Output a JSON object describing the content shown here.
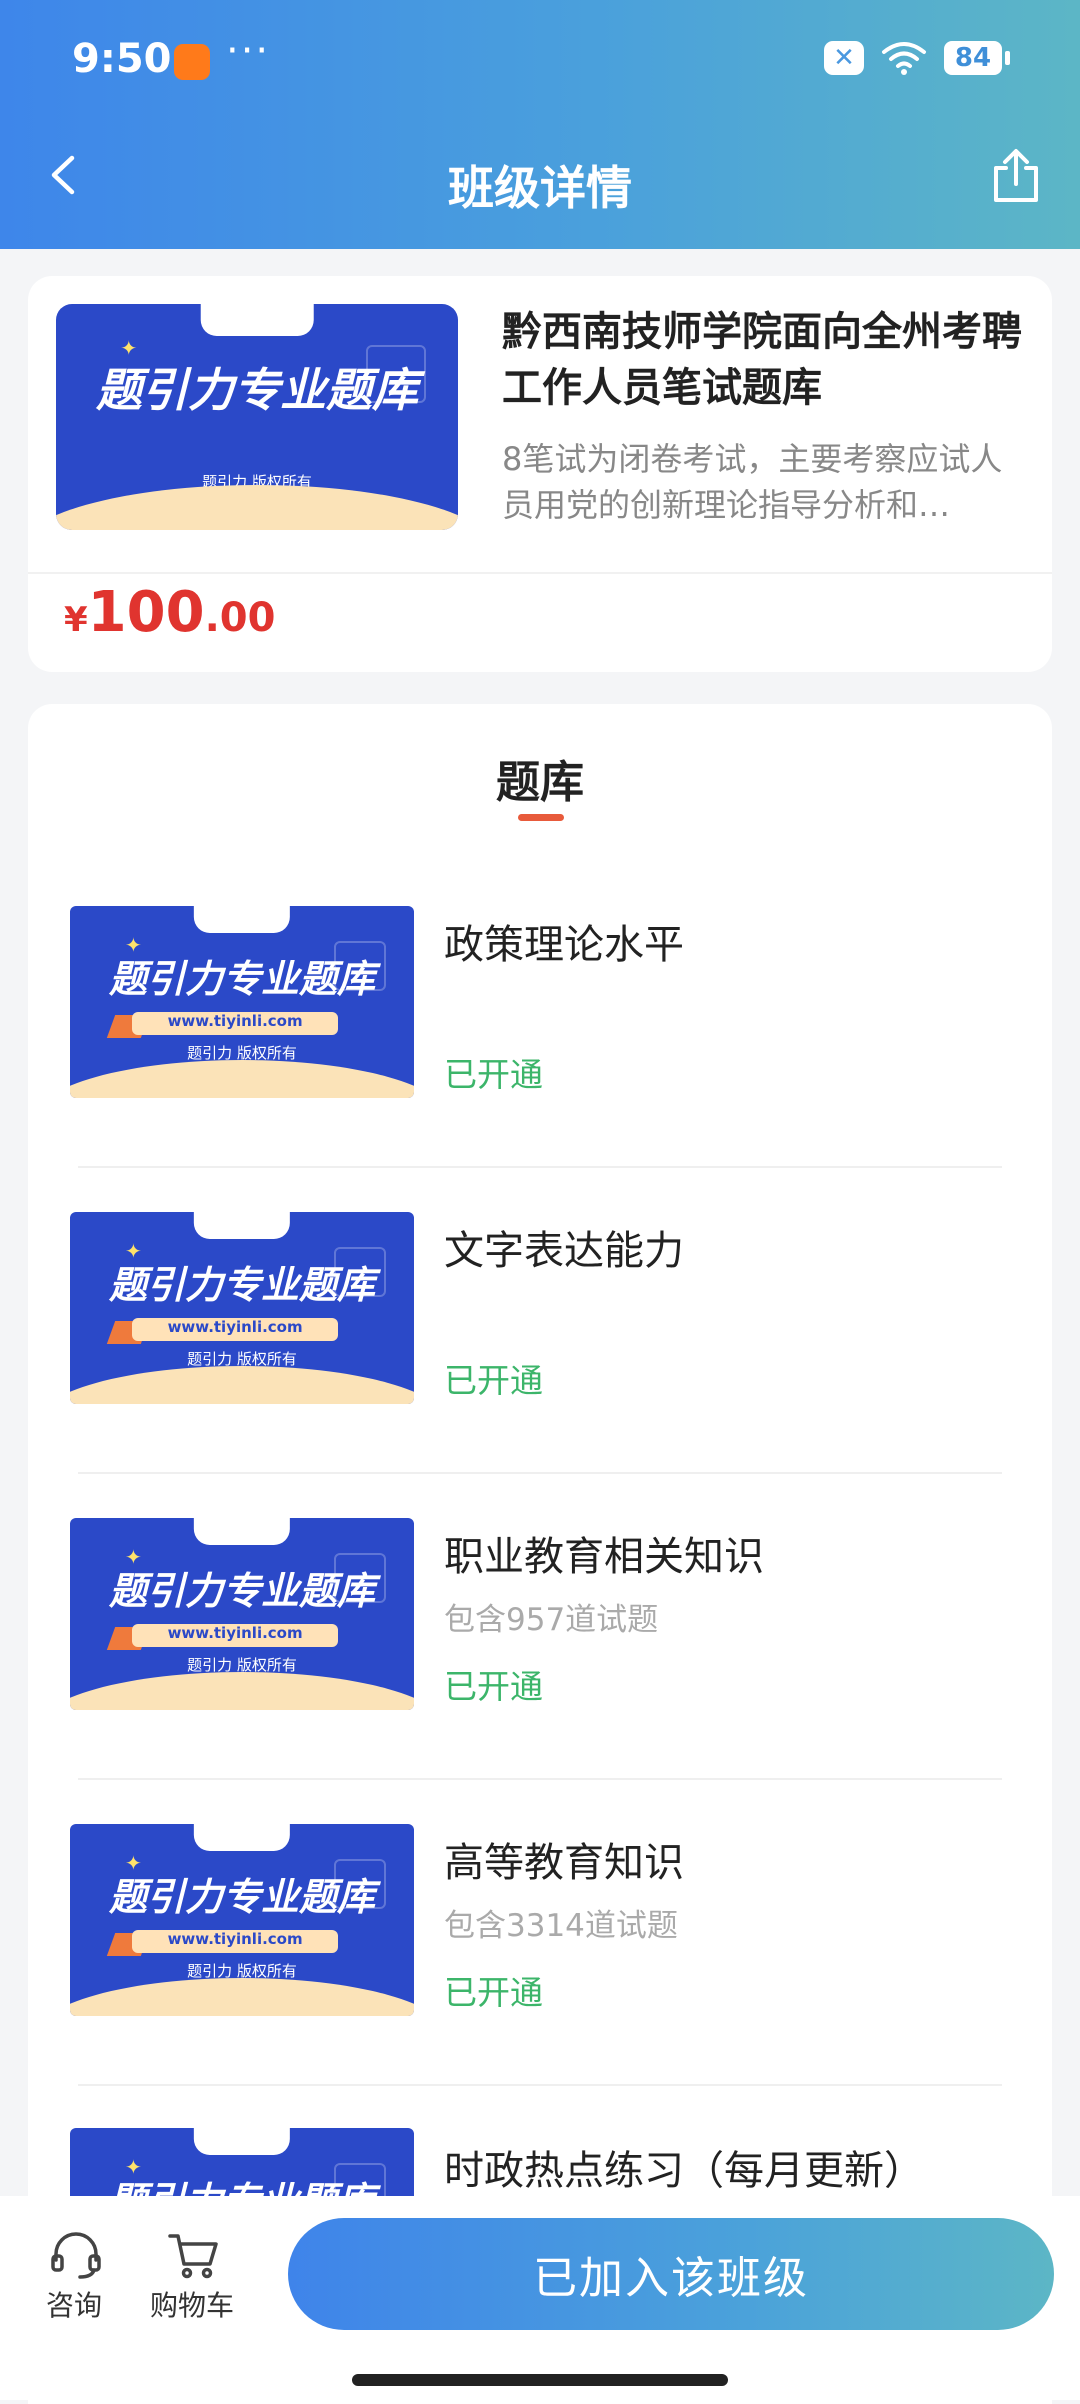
{
  "status_bar": {
    "time": "9:50",
    "dots": "···",
    "battery": "84",
    "app_icon": "shopping-bag-icon"
  },
  "header": {
    "title": "班级详情",
    "back_icon": "chevron-left-icon",
    "share_icon": "share-icon"
  },
  "course": {
    "cover": {
      "title": "题引力专业题库",
      "copyright": "题引力 版权所有"
    },
    "title": "黔西南技师学院面向全州考聘工作人员笔试题库",
    "description": "8笔试为闭卷考试，主要考察应试人员用党的创新理论指导分析和…",
    "price": {
      "currency": "¥",
      "integer": "100",
      "decimal": ".00"
    }
  },
  "bank": {
    "heading": "题库",
    "cover": {
      "title": "题引力专业题库",
      "url": "www.tiyinli.com",
      "copyright": "题引力 版权所有"
    },
    "items": [
      {
        "name": "政策理论水平",
        "count": "",
        "status": "已开通"
      },
      {
        "name": "文字表达能力",
        "count": "",
        "status": "已开通"
      },
      {
        "name": "职业教育相关知识",
        "count": "包含957道试题",
        "status": "已开通"
      },
      {
        "name": "高等教育知识",
        "count": "包含3314道试题",
        "status": "已开通"
      },
      {
        "name": "时政热点练习（每月更新）",
        "count": "",
        "status": ""
      }
    ]
  },
  "bottom_bar": {
    "consult_label": "咨询",
    "cart_label": "购物车",
    "join_label": "已加入该班级",
    "consult_icon": "headset-icon",
    "cart_icon": "cart-icon"
  },
  "colors": {
    "accent_blue": "#3e86ea",
    "price_red": "#e0342f",
    "status_green": "#3cb56a",
    "cover_blue": "#2b49c8"
  }
}
